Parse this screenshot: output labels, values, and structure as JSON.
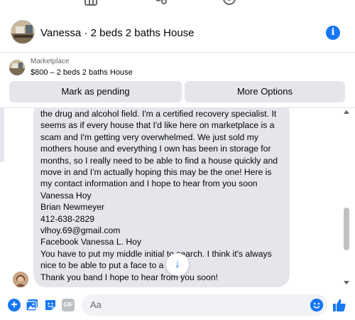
{
  "top_nav": {
    "icons": [
      "marketplace-icon",
      "groups-icon",
      "profile-icon"
    ]
  },
  "header": {
    "title": "Vanessa · 2 beds 2 baths House",
    "info_icon": "info-icon"
  },
  "marketplace": {
    "label": "Marketplace",
    "listing": "$800 – 2 beds 2 baths House",
    "pending_label": "Mark as pending",
    "options_label": "More Options"
  },
  "message": {
    "lines": [
      "the drug and alcohol field. I'm a certified recovery specialist. It",
      "seems as if every house that I'd like here on marketplace is a",
      "scam and I'm getting very overwhelmed. We just sold my",
      "mothers house and everything I own has been in storage for",
      "months, so I really need to be able to find a house quickly and",
      "move in and I'm actually hoping this may be the one! Here is",
      "my contact information and I hope to hear from you soon",
      "Vanessa Hoy",
      "Brian Newmeyer",
      "412-638-2829",
      "vlhoy.69@gmail.com",
      "Facebook Vanessa L. Hoy",
      "You have to put my middle initial to search. I think it's always",
      "nice to be able to put a face to a name",
      "Thank you band I hope to hear from you soon!"
    ]
  },
  "composer": {
    "placeholder": "Aa",
    "gif_label": "GIF"
  },
  "colors": {
    "accent": "#1877f2",
    "bubble": "#e4e6eb",
    "button_bg": "#e4e6eb"
  }
}
